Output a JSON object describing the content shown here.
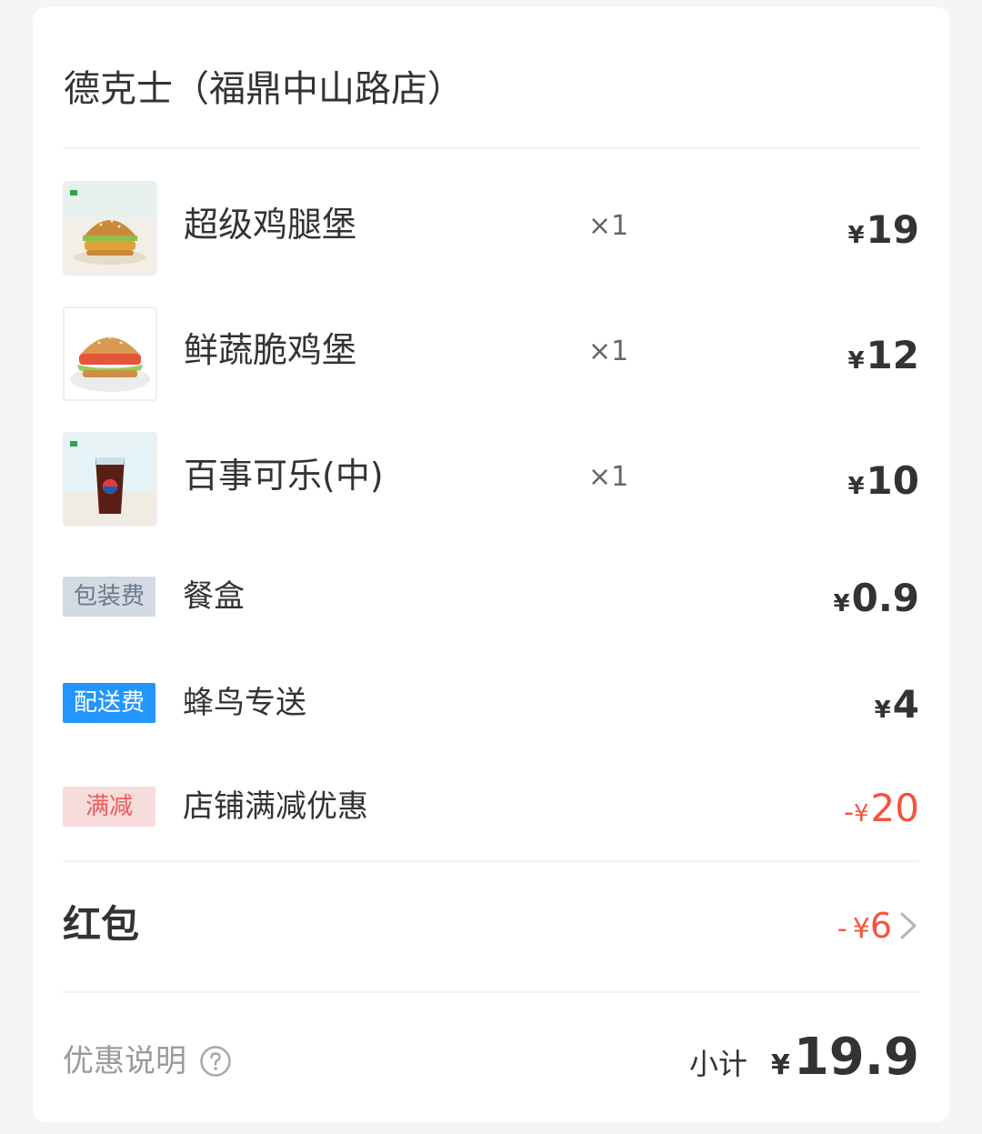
{
  "store": {
    "name": "德克士（福鼎中山路店）"
  },
  "currency": "¥",
  "items": [
    {
      "name": "超级鸡腿堡",
      "qty": "×1",
      "price": "19",
      "thumb": "burger-crispy-icon"
    },
    {
      "name": "鲜蔬脆鸡堡",
      "qty": "×1",
      "price": "12",
      "thumb": "burger-veggie-icon"
    },
    {
      "name": "百事可乐(中)",
      "qty": "×1",
      "price": "10",
      "thumb": "cola-cup-icon"
    }
  ],
  "fees": {
    "packaging": {
      "tag": "包装费",
      "name": "餐盒",
      "price": "0.9"
    },
    "delivery": {
      "tag": "配送费",
      "name": "蜂鸟专送",
      "price": "4"
    },
    "discount": {
      "tag": "满减",
      "name": "店铺满减优惠",
      "minus": "-",
      "price": "20"
    }
  },
  "redpack": {
    "label": "红包",
    "minus": "-",
    "value": "6"
  },
  "summary": {
    "promo_label": "优惠说明",
    "subtotal_label": "小计",
    "subtotal_value": "19.9"
  },
  "colors": {
    "accent_blue": "#2395ff",
    "discount_red": "#f5533d",
    "text_primary": "#333333",
    "text_muted": "#9a9a9a"
  }
}
